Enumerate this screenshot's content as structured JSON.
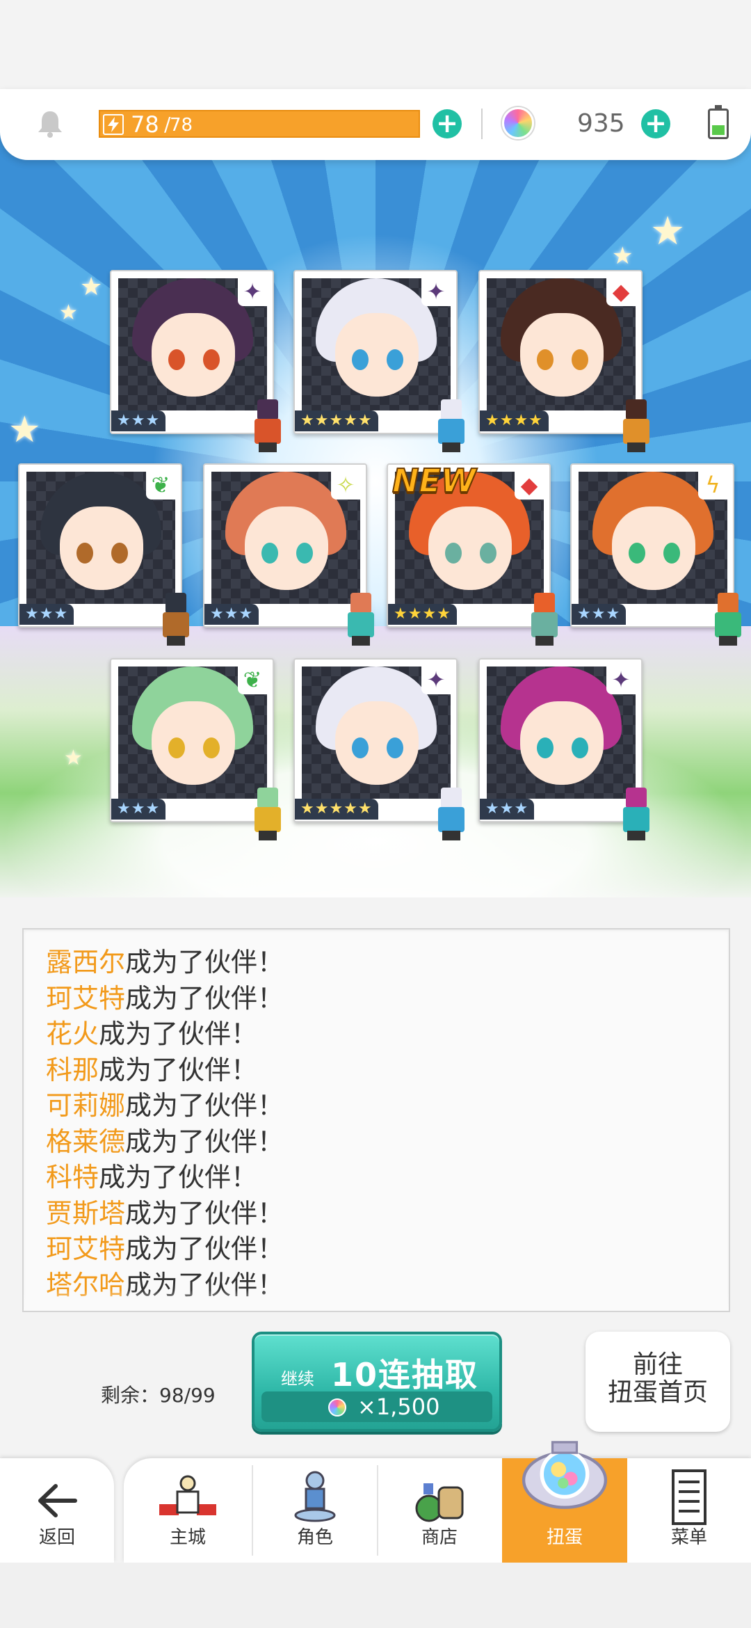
{
  "status_bar": {
    "stamina_current": "78",
    "stamina_separator": "/",
    "stamina_max": "78",
    "gem_count": "935",
    "icons": [
      "bell-icon",
      "lightning-icon",
      "plus-icon",
      "rainbow-gem-icon",
      "plus-icon",
      "battery-icon"
    ]
  },
  "colors": {
    "stamina_bar": "#f7a12a",
    "plus_button": "#20c0a4",
    "name_highlight": "#f29a1b",
    "gacha_button": "#2fb8a8",
    "active_tab": "#f7a12a"
  },
  "results": {
    "new_badge": "NEW",
    "cards": [
      {
        "rarity": 3,
        "stars": "★★★",
        "element": "dark-diamond-icon",
        "hair": "#4a2f52"
      },
      {
        "rarity": 5,
        "stars": "★★★★★",
        "element": "dark-diamond-icon",
        "hair": "#e9e9f4"
      },
      {
        "rarity": 4,
        "stars": "★★★★",
        "element": "fire-diamond-icon",
        "hair": "#4a2a22"
      },
      {
        "rarity": 3,
        "stars": "★★★",
        "element": "wind-leaf-icon",
        "hair": "#2e3440"
      },
      {
        "rarity": 3,
        "stars": "★★★",
        "element": "light-sparkle-icon",
        "hair": "#e07a55"
      },
      {
        "rarity": 4,
        "stars": "★★★★",
        "element": "fire-diamond-icon",
        "hair": "#e8602a",
        "is_new": true
      },
      {
        "rarity": 3,
        "stars": "★★★",
        "element": "thunder-bolt-icon",
        "hair": "#e0702e"
      },
      {
        "rarity": 3,
        "stars": "★★★",
        "element": "wind-leaf-icon",
        "hair": "#8fd39b"
      },
      {
        "rarity": 5,
        "stars": "★★★★★",
        "element": "dark-diamond-icon",
        "hair": "#e9e9f4"
      },
      {
        "rarity": 3,
        "stars": "★★★",
        "element": "dark-diamond-icon",
        "hair": "#b6338f"
      }
    ]
  },
  "log": {
    "suffix": "成为了伙伴！",
    "entries": [
      {
        "name": "露西尔"
      },
      {
        "name": "珂艾特"
      },
      {
        "name": "花火"
      },
      {
        "name": "科那"
      },
      {
        "name": "可莉娜"
      },
      {
        "name": "格莱德"
      },
      {
        "name": "科特"
      },
      {
        "name": "贾斯塔"
      },
      {
        "name": "珂艾特"
      },
      {
        "name": "塔尔哈"
      }
    ]
  },
  "actions": {
    "remaining": "剩余：98/99",
    "continue_label": "继续",
    "gacha_label": "10连抽取",
    "cost": "×1,500",
    "home_line1": "前往",
    "home_line2": "扭蛋首页"
  },
  "nav": {
    "back": "返回",
    "items": [
      {
        "label": "主城",
        "icon": "castle-icon",
        "active": false
      },
      {
        "label": "角色",
        "icon": "character-icon",
        "active": false
      },
      {
        "label": "商店",
        "icon": "shop-bag-icon",
        "active": false
      },
      {
        "label": "扭蛋",
        "icon": "gacha-machine-icon",
        "active": true
      },
      {
        "label": "菜单",
        "icon": "menu-list-icon",
        "active": false
      }
    ]
  }
}
